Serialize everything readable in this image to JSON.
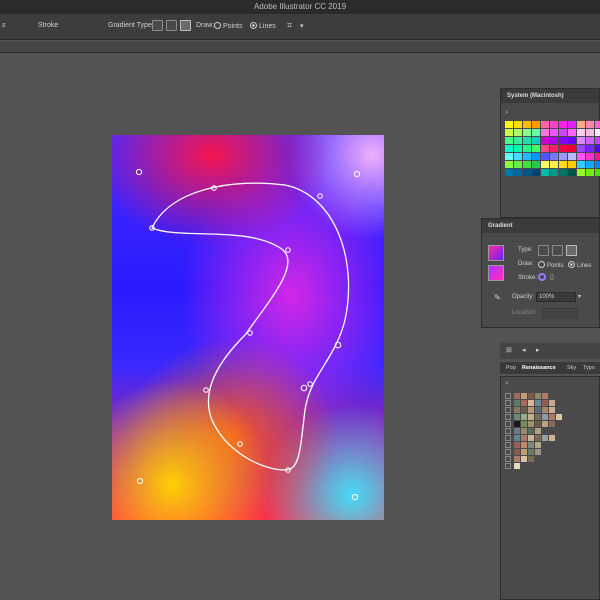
{
  "window": {
    "title": "Adobe Illustrator CC 2019"
  },
  "control_bar": {
    "left_fragment": "s",
    "stroke_label": "Stroke",
    "gradient_type_label": "Gradient Type:",
    "draw_label": "Draw:",
    "points_label": "Points",
    "lines_label": "Lines",
    "selected_draw": "Lines"
  },
  "swatches_panel": {
    "title": "System (Macintosh)",
    "colors": [
      "#ffff00",
      "#ffdd00",
      "#ffbb00",
      "#ff9900",
      "#ff66aa",
      "#ff44cc",
      "#ff22ee",
      "#dd22ff",
      "#ffaa88",
      "#ff88aa",
      "#ee66dd",
      "#ff99ff",
      "#ccff44",
      "#aaff66",
      "#88ff88",
      "#66ffaa",
      "#ff77dd",
      "#ee55ff",
      "#cc44ff",
      "#ff66ff",
      "#ffccee",
      "#ffbbdd",
      "#eeeeff",
      "#ddccff",
      "#44ff88",
      "#33ee99",
      "#22ddaa",
      "#11ccbb",
      "#cc00cc",
      "#aa00ee",
      "#8800ff",
      "#6600ff",
      "#dd88ff",
      "#cc66ff",
      "#bb44ff",
      "#aa22ff",
      "#00ffcc",
      "#00ffaa",
      "#22ff88",
      "#44ff66",
      "#ff4488",
      "#ff2266",
      "#ff0044",
      "#ee0033",
      "#9944ff",
      "#7722ff",
      "#5500ff",
      "#3300ee",
      "#66ffff",
      "#44ddff",
      "#22bbff",
      "#0099ff",
      "#5555ff",
      "#7777ff",
      "#9999ff",
      "#bbbbff",
      "#ff55ff",
      "#ff33cc",
      "#ff1199",
      "#ee0077",
      "#88ff44",
      "#66ee44",
      "#44dd44",
      "#22cc44",
      "#ffff66",
      "#ffee44",
      "#ffdd22",
      "#ffcc00",
      "#33ccff",
      "#11aaff",
      "#0088ee",
      "#0066dd",
      "#0077aa",
      "#006699",
      "#005588",
      "#004477",
      "#00bbaa",
      "#009988",
      "#007766",
      "#005544",
      "#99ff22",
      "#77ee11",
      "#55dd00",
      "#33cc00"
    ]
  },
  "gradient_panel": {
    "title": "Gradient",
    "type_label": "Type:",
    "draw_label": "Draw:",
    "points_label": "Points",
    "lines_label": "Lines",
    "selected_draw": "Lines",
    "stroke_label": "Stroke:",
    "opacity_label": "Opacity:",
    "opacity_value": "100%",
    "location_label": "Location:"
  },
  "library_tabs": {
    "tab1": "Pop",
    "tab2": "Renaissance",
    "tab3": "Sky",
    "tab4": "Typo",
    "active": "Renaissance"
  },
  "library_swatches": {
    "rows": [
      [
        "#a06a58",
        "#c49a7a",
        "#7a5a4a",
        "#8a8a6a",
        "#b07a6a"
      ],
      [
        "#5a7a6a",
        "#aa6a5a",
        "#d8b89a",
        "#6a8a9a",
        "#9a5a4a",
        "#c8a888"
      ],
      [
        "#8a7a5a",
        "#6a5a4a",
        "#b89a7a",
        "#5a6a7a",
        "#a8886a",
        "#cab090"
      ],
      [
        "#6a8a7a",
        "#9aaa8a",
        "#c0b090",
        "#7a6a5a",
        "#8a9aaa",
        "#b07868",
        "#d8c8a8"
      ],
      [
        "#1a1a1a",
        "#7a8a5a",
        "#a0906a",
        "#6a5a4a",
        "#c0a080",
        "#8a6a5a"
      ],
      [
        "#6a7a8a",
        "#9a8a6a",
        "#5a6a5a",
        "#b0a080"
      ],
      [
        "#5a8a8a",
        "#aa7a6a",
        "#c8b898",
        "#7a6a5a",
        "#9aa0a0",
        "#d0b090"
      ],
      [
        "#a05a5a",
        "#c08a6a",
        "#7a8a7a",
        "#b0a888"
      ],
      [
        "#8a5a4a",
        "#c0a070",
        "#6a7a6a",
        "#a09080"
      ],
      [
        "#b0786a",
        "#d8c0a0",
        "#7a6a5a"
      ],
      [
        "#e8d8c0"
      ]
    ]
  },
  "colors": {
    "ui_dark": "#535353",
    "panel": "#4a4a4a",
    "titlebar": "#2b2b2b"
  }
}
